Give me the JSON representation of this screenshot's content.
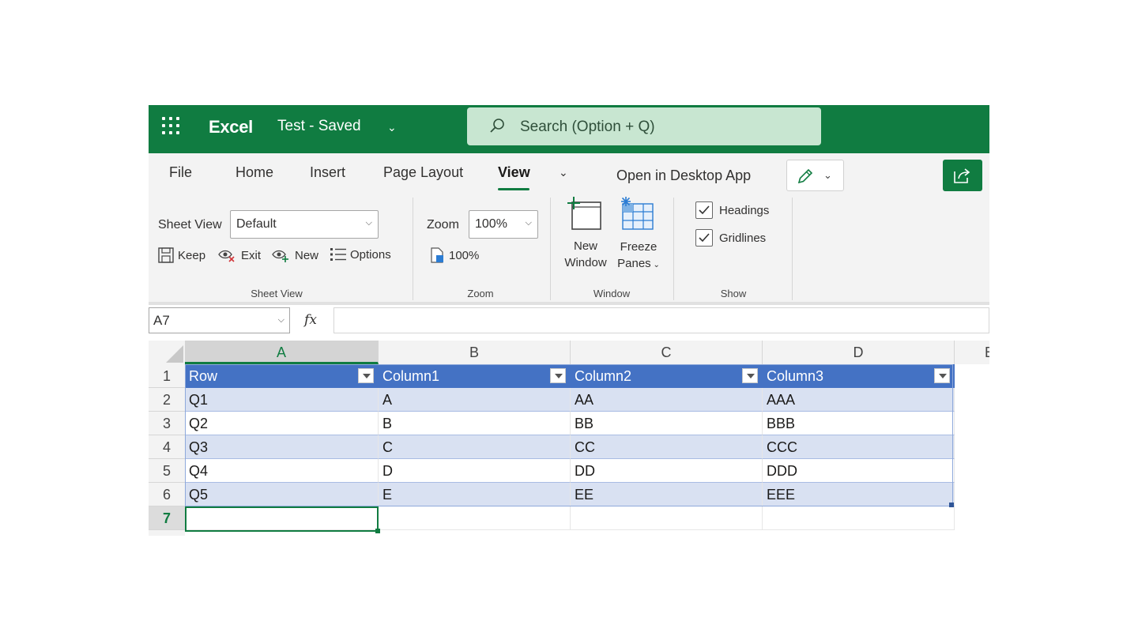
{
  "titlebar": {
    "app_name": "Excel",
    "doc_name": "Test - Saved",
    "search_placeholder": "Search (Option + Q)",
    "brand_color": "#107c41"
  },
  "ribbon": {
    "tabs": [
      {
        "label": "File"
      },
      {
        "label": "Home"
      },
      {
        "label": "Insert"
      },
      {
        "label": "Page Layout"
      },
      {
        "label": "View",
        "active": true
      }
    ],
    "open_desktop": "Open in Desktop App",
    "sheet_view": {
      "label": "Sheet View",
      "selected": "Default",
      "keep": "Keep",
      "exit": "Exit",
      "new": "New",
      "options": "Options",
      "group_label": "Sheet View"
    },
    "zoom": {
      "label": "Zoom",
      "selected": "100%",
      "reset": "100%",
      "group_label": "Zoom"
    },
    "window": {
      "new_window_line1": "New",
      "new_window_line2": "Window",
      "freeze_line1": "Freeze",
      "freeze_line2": "Panes",
      "group_label": "Window"
    },
    "show": {
      "headings": "Headings",
      "gridlines": "Gridlines",
      "headings_checked": true,
      "gridlines_checked": true,
      "group_label": "Show"
    }
  },
  "formula_bar": {
    "name_box": "A7",
    "fx": "fx",
    "value": ""
  },
  "grid": {
    "columns": [
      "A",
      "B",
      "C",
      "D"
    ],
    "next_column": "E",
    "rows": [
      "1",
      "2",
      "3",
      "4",
      "5",
      "6",
      "7"
    ],
    "selected_column": "A",
    "selected_row": "7",
    "table_headers": [
      "Row",
      "Column1",
      "Column2",
      "Column3"
    ],
    "table_rows": [
      [
        "Q1",
        "A",
        "AA",
        "AAA"
      ],
      [
        "Q2",
        "B",
        "BB",
        "BBB"
      ],
      [
        "Q3",
        "C",
        "CC",
        "CCC"
      ],
      [
        "Q4",
        "D",
        "DD",
        "DDD"
      ],
      [
        "Q5",
        "E",
        "EE",
        "EEE"
      ]
    ],
    "colors": {
      "header_fill": "#4472c4",
      "band_fill": "#d9e1f2",
      "selection": "#107c41"
    }
  }
}
